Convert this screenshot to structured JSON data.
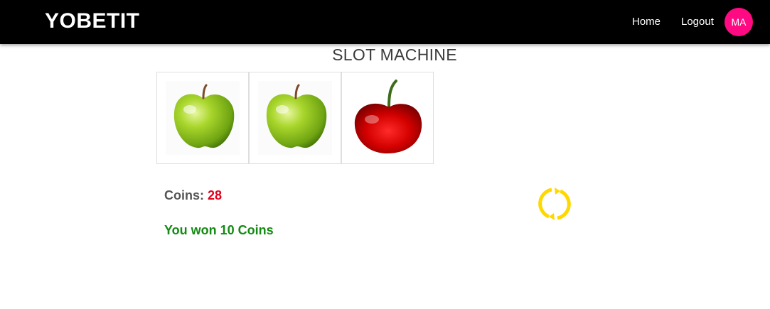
{
  "navbar": {
    "brand": "YOBETIT",
    "links": [
      "Home",
      "Logout"
    ],
    "avatar_initials": "MA",
    "avatar_color": "#ff0a82"
  },
  "page": {
    "title": "SLOT MACHINE"
  },
  "reels": [
    {
      "symbol": "green-apple"
    },
    {
      "symbol": "green-apple"
    },
    {
      "symbol": "cherry"
    }
  ],
  "stats": {
    "coins_label": "Coins:",
    "coins_value": "28",
    "result_message": "You won 10 Coins"
  },
  "colors": {
    "coins_value": "#e3001b",
    "result_message": "#138a12",
    "spin_icon": "#ffd800"
  },
  "icons": {
    "spin": "refresh-icon"
  }
}
